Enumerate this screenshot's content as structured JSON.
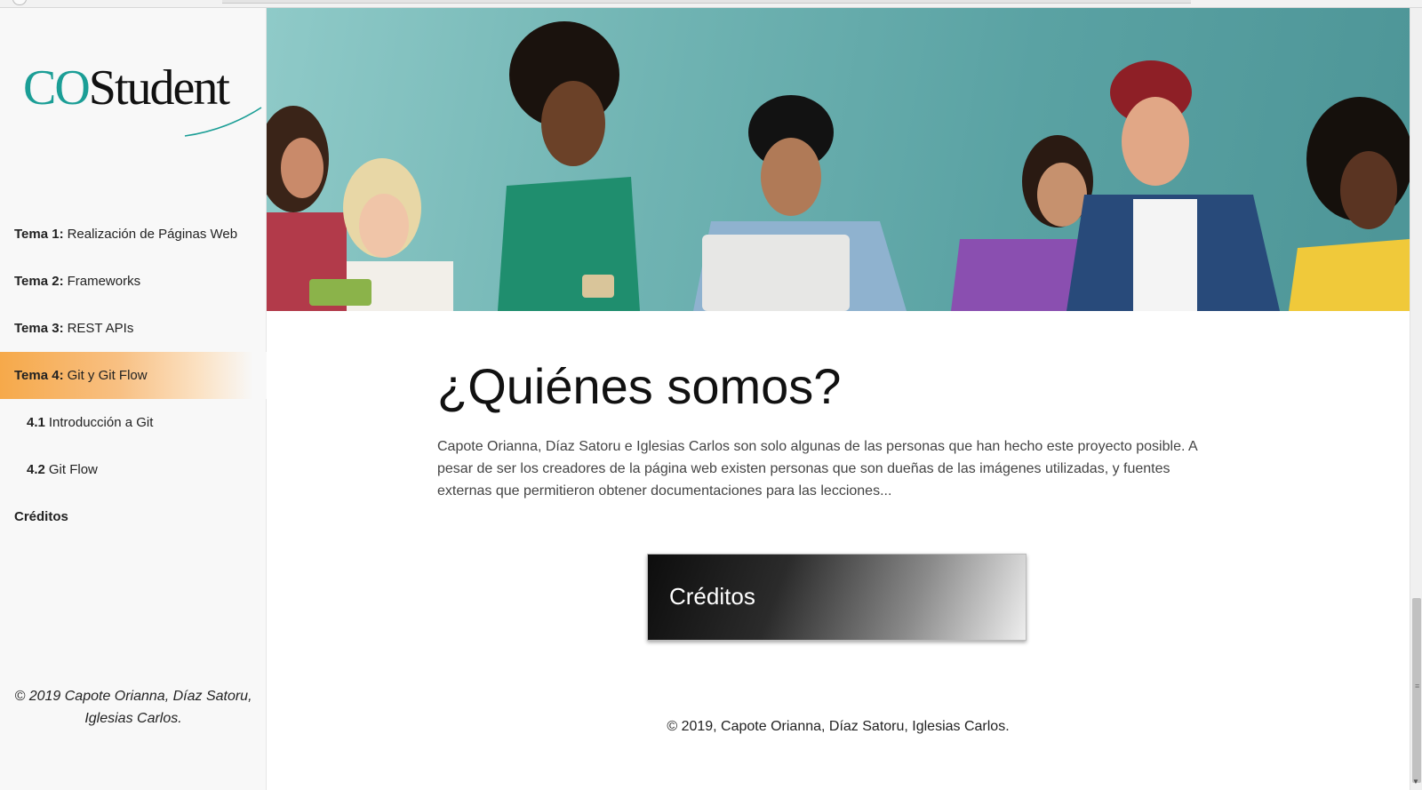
{
  "logo": {
    "part1": "CO",
    "part2": "Student"
  },
  "nav": {
    "items": [
      {
        "strong": "Tema 1:",
        "label": "Realización de Páginas Web"
      },
      {
        "strong": "Tema 2:",
        "label": "Frameworks"
      },
      {
        "strong": "Tema 3:",
        "label": "REST APIs"
      },
      {
        "strong": "Tema 4:",
        "label": "Git y Git Flow"
      },
      {
        "strong": "4.1",
        "label": "Introducción a Git"
      },
      {
        "strong": "4.2",
        "label": "Git Flow"
      },
      {
        "strong": "Créditos",
        "label": ""
      }
    ]
  },
  "sidebar_footer": {
    "line1": "© 2019 Capote Orianna, Díaz Satoru,",
    "line2": "Iglesias Carlos."
  },
  "main": {
    "title": "¿Quiénes somos?",
    "paragraph": "Capote Orianna, Díaz Satoru e Iglesias Carlos son solo algunas de las personas que han hecho este proyecto posible. A pesar de ser los creadores de la página web existen personas que son dueñas de las imágenes utilizadas, y fuentes externas que permitieron obtener documentaciones para las lecciones...",
    "credits_button": "Créditos",
    "footer": "© 2019, Capote Orianna, Díaz Satoru, Iglesias Carlos."
  },
  "colors": {
    "brand_teal": "#1b9e96",
    "active_orange": "#f6a94a",
    "hero_teal": "#6fb3b2"
  }
}
